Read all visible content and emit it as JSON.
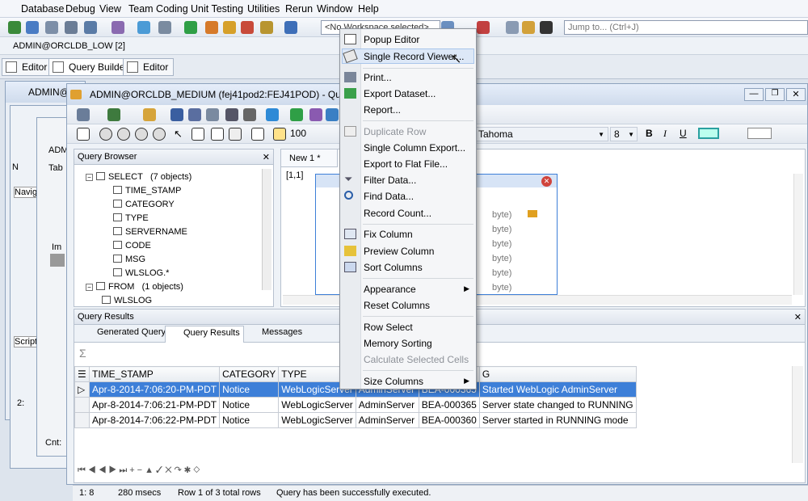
{
  "menubar": {
    "items": [
      "Database",
      "Debug",
      "View",
      "Team Coding",
      "Unit Testing",
      "Utilities",
      "Rerun",
      "Window",
      "Help"
    ]
  },
  "toolbar": {
    "workspace_value": "<No Workspace selected>",
    "jump_placeholder": "Jump to... (Ctrl+J)"
  },
  "connection_bar": {
    "label": "ADMIN@ORCLDB_LOW [2]"
  },
  "tabs": {
    "editor1": "Editor",
    "query_builder": "Query Builder",
    "editor2": "Editor"
  },
  "bg_window": {
    "title": "ADMIN@..."
  },
  "qb_window": {
    "title": "ADMIN@ORCLDB_MEDIUM (fej41pod2:FEJ41POD) - Query Build"
  },
  "left_strip": {
    "scripts": "Script",
    "navig": "Navig",
    "count": "2:",
    "cnt": "Cnt:",
    "adm": "ADM",
    "tab": "Tab",
    "im": "Im",
    "n": "N"
  },
  "qb_toolbar": {
    "zoom": "100",
    "font": "Tahoma",
    "size": "8",
    "bold": "B",
    "italic": "I",
    "underline": "U"
  },
  "query_browser": {
    "title": "Query Browser",
    "select_label": "SELECT",
    "select_count": "(7 objects)",
    "fields": [
      "TIME_STAMP",
      "CATEGORY",
      "TYPE",
      "SERVERNAME",
      "CODE",
      "MSG",
      "WLSLOG.*"
    ],
    "from_label": "FROM",
    "from_count": "(1 objects)",
    "from_table": "WLSLOG"
  },
  "editor": {
    "tab": "New 1 *",
    "position": "[1,1]",
    "byte_labels": [
      "byte)",
      "byte)",
      "byte)",
      "byte)",
      "byte)",
      "byte)"
    ]
  },
  "results": {
    "panel_title": "Query Results",
    "tabs": [
      "Generated Query",
      "Query Results",
      "Messages"
    ],
    "sigma": "Σ",
    "columns": [
      "TIME_STAMP",
      "CATEGORY",
      "TYPE",
      "",
      "",
      "G"
    ],
    "rows": [
      [
        "Apr-8-2014-7:06:20-PM-PDT",
        "Notice",
        "WebLogicServer",
        "AdminServer",
        "BEA-000365",
        "Started WebLogic AdminServer"
      ],
      [
        "Apr-8-2014-7:06:21-PM-PDT",
        "Notice",
        "WebLogicServer",
        "AdminServer",
        "BEA-000365",
        "Server state changed to RUNNING"
      ],
      [
        "Apr-8-2014-7:06:22-PM-PDT",
        "Notice",
        "WebLogicServer",
        "AdminServer",
        "BEA-000360",
        "Server started in RUNNING mode"
      ]
    ],
    "row_marker": "▷"
  },
  "status": {
    "position": "1: 8",
    "time": "280 msecs",
    "rows": "Row 1 of 3 total rows",
    "message": "Query has been successfully executed."
  },
  "context_menu": {
    "items": [
      {
        "label": "Popup Editor"
      },
      {
        "label": "Single Record Viewer..."
      },
      {
        "label": "Print..."
      },
      {
        "label": "Export Dataset..."
      },
      {
        "label": "Report..."
      },
      {
        "label": "Duplicate Row"
      },
      {
        "label": "Single Column Export..."
      },
      {
        "label": "Export to Flat File..."
      },
      {
        "label": "Filter Data..."
      },
      {
        "label": "Find Data..."
      },
      {
        "label": "Record Count..."
      },
      {
        "label": "Fix Column"
      },
      {
        "label": "Preview Column"
      },
      {
        "label": "Sort Columns"
      },
      {
        "label": "Appearance"
      },
      {
        "label": "Reset Columns"
      },
      {
        "label": "Row Select"
      },
      {
        "label": "Memory Sorting"
      },
      {
        "label": "Calculate Selected Cells"
      },
      {
        "label": "Size Columns"
      }
    ]
  },
  "colors": {
    "accent": "#3d7fd8",
    "menu_bg": "#f5f6f8",
    "highlight": "#dde8f7"
  }
}
